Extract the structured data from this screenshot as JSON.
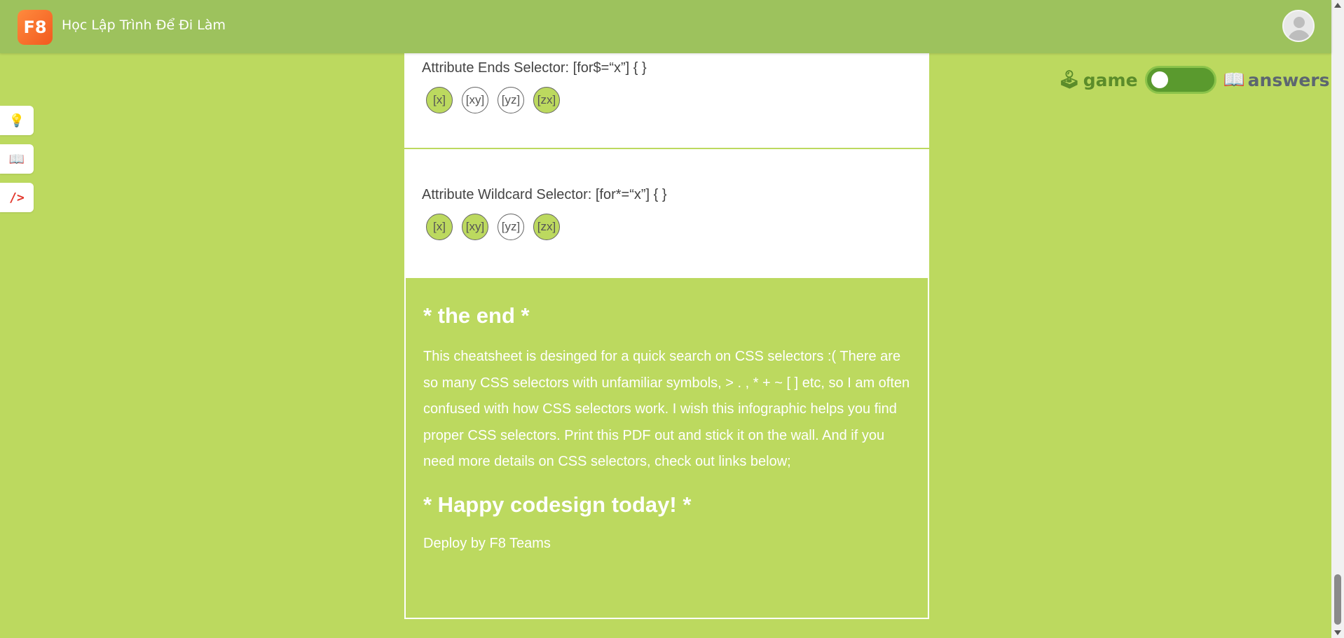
{
  "header": {
    "logo_text": "F8",
    "title": "Học Lập Trình Để Đi Làm"
  },
  "sidebar": {
    "items": [
      {
        "icon": "lightbulb-icon",
        "glyph": "💡"
      },
      {
        "icon": "book-icon",
        "glyph": "📖"
      },
      {
        "icon": "code-icon",
        "glyph": "/>"
      }
    ]
  },
  "mode_toggle": {
    "game_icon": "🕹",
    "game_label": "game",
    "answers_icon": "📖",
    "answers_label": "answers",
    "state": "game"
  },
  "cards": [
    {
      "title": "Attribute Ends Selector: [for$=“x”] { }",
      "chips": [
        {
          "label": "[x]",
          "selected": true
        },
        {
          "label": "[xy]",
          "selected": false
        },
        {
          "label": "[yz]",
          "selected": false
        },
        {
          "label": "[zx]",
          "selected": true
        }
      ]
    },
    {
      "title": "Attribute Wildcard Selector: [for*=“x”] { }",
      "chips": [
        {
          "label": "[x]",
          "selected": true
        },
        {
          "label": "[xy]",
          "selected": true
        },
        {
          "label": "[yz]",
          "selected": false
        },
        {
          "label": "[zx]",
          "selected": true
        }
      ]
    }
  ],
  "ending": {
    "title": "* the end *",
    "body": "This cheatsheet is desinged for a quick search on CSS selectors :( There are so many CSS selectors with unfamiliar symbols, > . , * + ~ [ ] etc, so I am often confused with how CSS selectors work. I wish this infographic helps you find proper CSS selectors. Print this PDF out and stick it on the wall. And if you need more details on CSS selectors, check out links below;",
    "title2": "* Happy codesign today! *",
    "deploy": "Deploy by F8 Teams"
  },
  "colors": {
    "background": "#bcd95f",
    "header": "#9dc25d",
    "logo": "#f25a1f",
    "toggle": "#5a9a2e"
  }
}
